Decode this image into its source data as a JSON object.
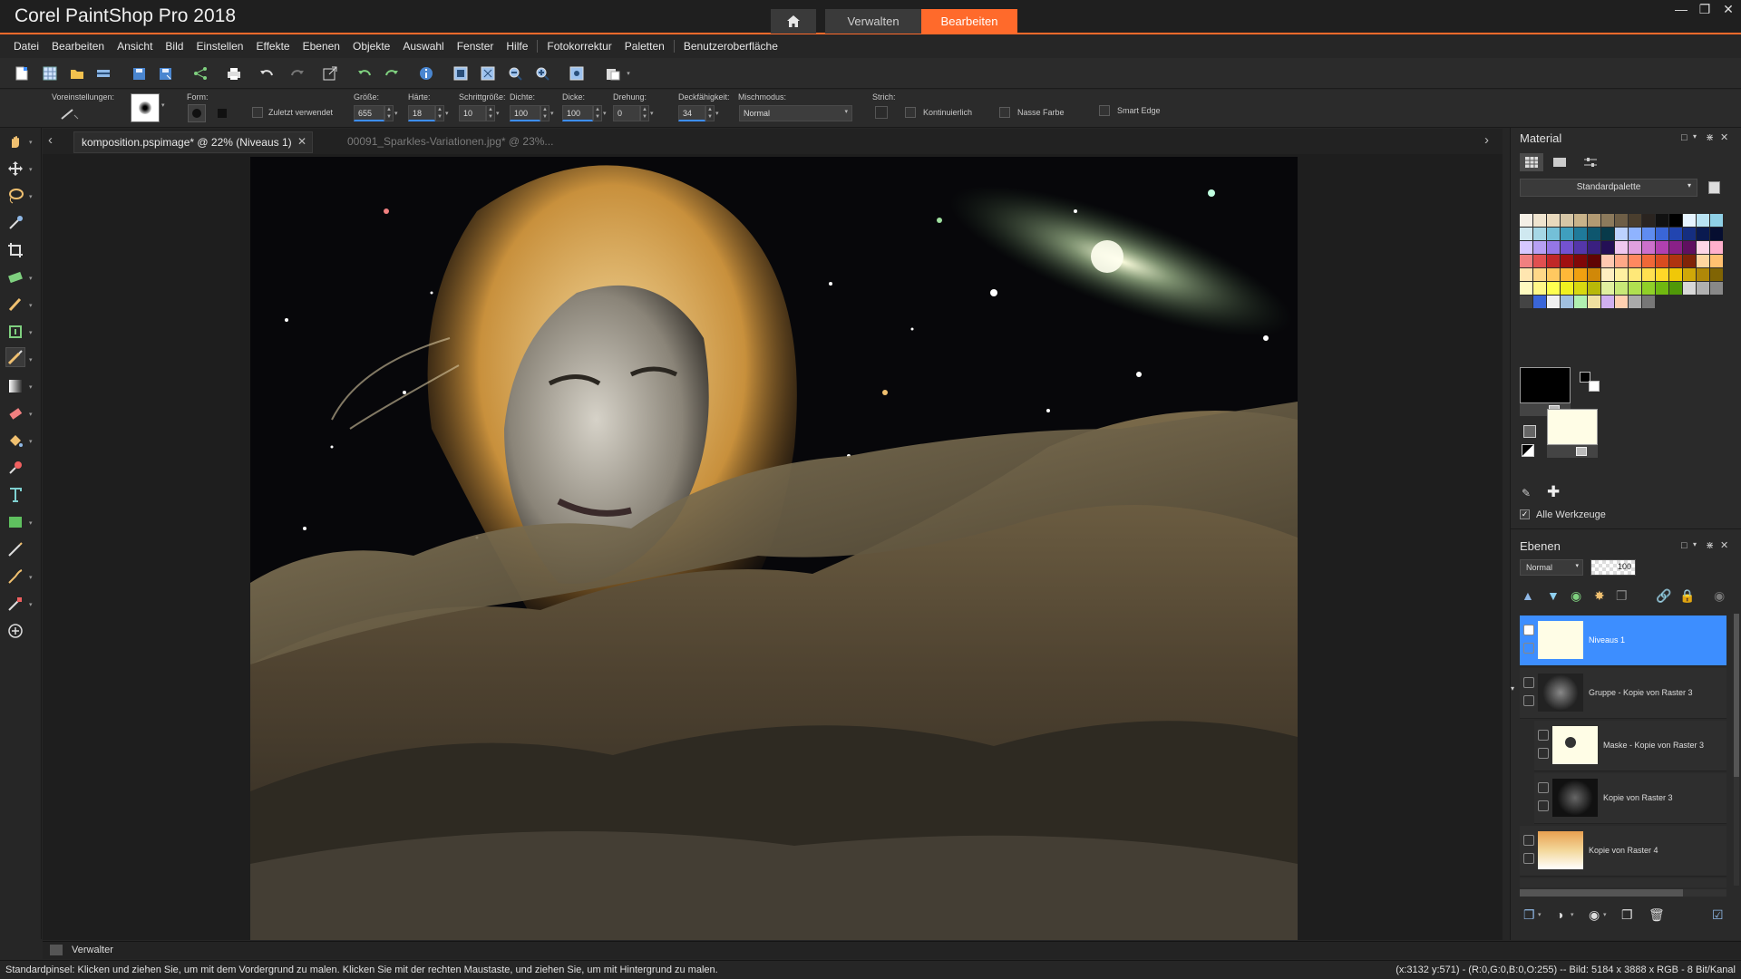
{
  "app": {
    "title": "Corel PaintShop Pro 2018",
    "tabs": {
      "manage": "Verwalten",
      "edit": "Bearbeiten"
    }
  },
  "menu": [
    "Datei",
    "Bearbeiten",
    "Ansicht",
    "Bild",
    "Einstellen",
    "Effekte",
    "Ebenen",
    "Objekte",
    "Auswahl",
    "Fenster",
    "Hilfe",
    "Fotokorrektur",
    "Paletten",
    "Benutzeroberfläche"
  ],
  "options": {
    "presets_label": "Voreinstellungen:",
    "form_label": "Form:",
    "recent_label": "Zuletzt verwendet",
    "size_label": "Größe:",
    "size_value": "655",
    "hardness_label": "Härte:",
    "hardness_value": "18",
    "step_label": "Schrittgröße:",
    "step_value": "10",
    "density_label": "Dichte:",
    "density_value": "100",
    "thickness_label": "Dicke:",
    "thickness_value": "100",
    "rotation_label": "Drehung:",
    "rotation_value": "0",
    "opacity_label": "Deckfähigkeit:",
    "opacity_value": "34",
    "blend_label": "Mischmodus:",
    "blend_value": "Normal",
    "stroke_label": "Strich:",
    "continuous_label": "Kontinuierlich",
    "wet_label": "Nasse Farbe",
    "smartedge_label": "Smart Edge"
  },
  "document": {
    "active_tab": "komposition.pspimage* @  22% (Niveaus 1)",
    "inactive_tab": "00091_Sparkles-Variationen.jpg* @  23%..."
  },
  "material": {
    "title": "Material",
    "palette": "Standardpalette",
    "all_tools": "Alle Werkzeuge"
  },
  "layers": {
    "title": "Ebenen",
    "blend": "Normal",
    "opacity": "100",
    "items": [
      {
        "name": "Niveaus 1",
        "selected": true
      },
      {
        "name": "Gruppe - Kopie von Raster 3"
      },
      {
        "name": "Maske - Kopie von Raster 3"
      },
      {
        "name": "Kopie von Raster 3"
      },
      {
        "name": "Kopie von Raster 4"
      }
    ]
  },
  "organizer": {
    "label": "Verwalter"
  },
  "status": {
    "hint": "Standardpinsel: Klicken und ziehen Sie, um mit dem Vordergrund zu malen. Klicken Sie mit der rechten Maustaste, und ziehen Sie, um mit Hintergrund zu malen.",
    "info": "(x:3132 y:571) - (R:0,G:0,B:0,O:255) -- Bild: 5184 x 3888 x RGB - 8 Bit/Kanal"
  },
  "colors": {
    "accent": "#ff6a2b",
    "selection": "#3d8eff"
  }
}
